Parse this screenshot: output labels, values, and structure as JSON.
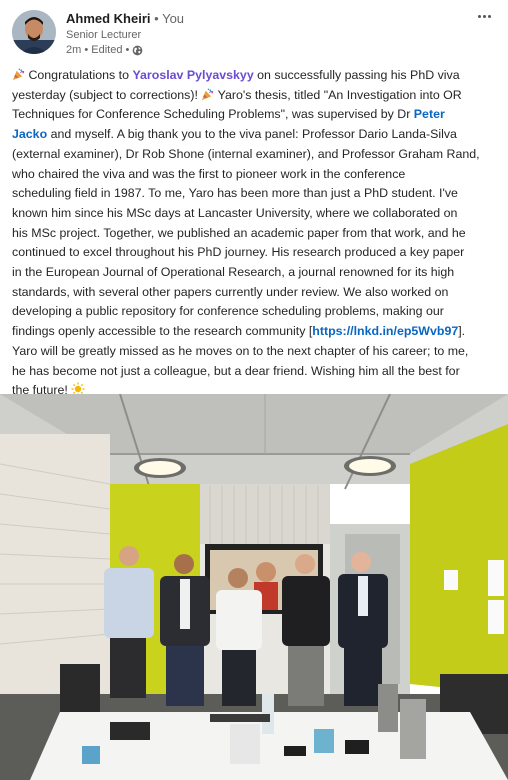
{
  "author": {
    "name": "Ahmed Kheiri",
    "separator": "•",
    "relation": "You",
    "title": "Senior Lecturer",
    "meta": "2m • Edited •",
    "globe_icon": "globe-icon"
  },
  "menu": {
    "icon": "more-options-icon"
  },
  "post": {
    "lines": [
      [
        {
          "t": "icon",
          "v": "party-popper-icon"
        },
        {
          "t": "text",
          "v": " Congratulations to "
        },
        {
          "t": "mention",
          "v": "Yaroslav Pylyavskyy"
        },
        {
          "t": "text",
          "v": " on successfully passing his PhD viva"
        }
      ],
      [
        {
          "t": "text",
          "v": "yesterday (subject to corrections)! "
        },
        {
          "t": "icon",
          "v": "party-popper-icon"
        },
        {
          "t": "text",
          "v": " Yaro's thesis, titled \"An Investigation into OR"
        }
      ],
      [
        {
          "t": "text",
          "v": "Techniques for Conference Scheduling Problems\", was supervised by Dr "
        },
        {
          "t": "link",
          "v": "Peter"
        }
      ],
      [
        {
          "t": "link",
          "v": "Jacko"
        },
        {
          "t": "text",
          "v": " and myself. A big thank you to the viva panel: Professor Dario Landa-Silva"
        }
      ],
      [
        {
          "t": "text",
          "v": "(external examiner), Dr Rob Shone (internal examiner), and Professor Graham Rand,"
        }
      ],
      [
        {
          "t": "text",
          "v": "who chaired the viva and was the first to pioneer work in the conference"
        }
      ],
      [
        {
          "t": "text",
          "v": "scheduling field in 1987. To me, Yaro has been more than just a PhD student. I've"
        }
      ],
      [
        {
          "t": "text",
          "v": "known him since his MSc days at Lancaster University, where we collaborated on"
        }
      ],
      [
        {
          "t": "text",
          "v": "his MSc project. Together, we published an academic paper from that work, and he"
        }
      ],
      [
        {
          "t": "text",
          "v": "continued to excel throughout his PhD journey. His research produced a key paper"
        }
      ],
      [
        {
          "t": "text",
          "v": "in the European Journal of Operational Research, a journal renowned for its high"
        }
      ],
      [
        {
          "t": "text",
          "v": "standards, with several other papers currently under review. We also worked on"
        }
      ],
      [
        {
          "t": "text",
          "v": "developing a public repository for conference scheduling problems, making our"
        }
      ],
      [
        {
          "t": "text",
          "v": "findings openly accessible to the research community ["
        },
        {
          "t": "link",
          "v": "https://lnkd.in/ep5Wvb97"
        },
        {
          "t": "text",
          "v": "]."
        }
      ],
      [
        {
          "t": "text",
          "v": "Yaro will be greatly missed as he moves on to the next chapter of his career; to me,"
        }
      ],
      [
        {
          "t": "text",
          "v": "he has become not just a colleague, but a dear friend. Wishing him all the best for"
        }
      ],
      [
        {
          "t": "text",
          "v": "the future! "
        },
        {
          "t": "icon",
          "v": "sun-icon"
        }
      ]
    ]
  },
  "colors": {
    "mention": "#6b4bd1",
    "link": "#0a66c2",
    "wall": "#c9d21c"
  }
}
